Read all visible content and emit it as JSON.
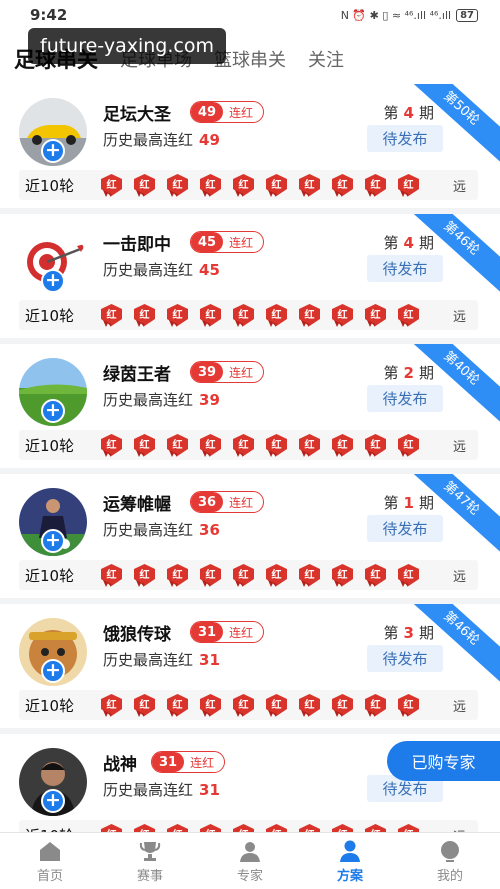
{
  "status_bar": {
    "time": "9:42",
    "icons": "N ⏰ ✱ ▯ ≈ ⁴⁶.ıll ⁴⁶.ıll",
    "battery": "87"
  },
  "watermark": "future-yaxing.com",
  "tabs": [
    {
      "label": "足球串关",
      "active": true
    },
    {
      "label": "足球单场",
      "active": false
    },
    {
      "label": "篮球串关",
      "active": false
    },
    {
      "label": "关注",
      "active": false
    }
  ],
  "labels": {
    "history_prefix": "历史最高连红",
    "streak_suffix": "连红",
    "period_prefix": "第",
    "period_suffix": "期",
    "recent": "近10轮",
    "badge": "红",
    "far": "远"
  },
  "experts": [
    {
      "name": "足坛大圣",
      "streak": "49",
      "history_max": "49",
      "period": "4",
      "status": "待发布",
      "corner": "第50轮",
      "avatar": "car-avatar"
    },
    {
      "name": "一击即中",
      "streak": "45",
      "history_max": "45",
      "period": "4",
      "status": "待发布",
      "corner": "第46轮",
      "avatar": "target-avatar"
    },
    {
      "name": "绿茵王者",
      "streak": "39",
      "history_max": "39",
      "period": "2",
      "status": "待发布",
      "corner": "第40轮",
      "avatar": "grassland-avatar"
    },
    {
      "name": "运筹帷幄",
      "streak": "36",
      "history_max": "36",
      "period": "1",
      "status": "待发布",
      "corner": "第47轮",
      "avatar": "soccer-player-avatar"
    },
    {
      "name": "饿狼传球",
      "streak": "31",
      "history_max": "31",
      "period": "3",
      "status": "待发布",
      "corner": "第46轮",
      "avatar": "monkey-king-avatar"
    },
    {
      "name": "战神",
      "streak": "31",
      "history_max": "31",
      "period": "",
      "status": "待发布",
      "corner": "",
      "avatar": "man-portrait-avatar"
    }
  ],
  "floating_button": "已购专家",
  "bottom_nav": [
    {
      "label": "首页",
      "icon": "home-icon",
      "active": false
    },
    {
      "label": "赛事",
      "icon": "trophy-icon",
      "active": false
    },
    {
      "label": "专家",
      "icon": "expert-icon",
      "active": false
    },
    {
      "label": "方案",
      "icon": "plan-person-icon",
      "active": true
    },
    {
      "label": "我的",
      "icon": "profile-icon",
      "active": false
    }
  ],
  "colors": {
    "accent_blue": "#1e7bea",
    "accent_red": "#e53935",
    "corner_blue": "#2f8ef5"
  }
}
